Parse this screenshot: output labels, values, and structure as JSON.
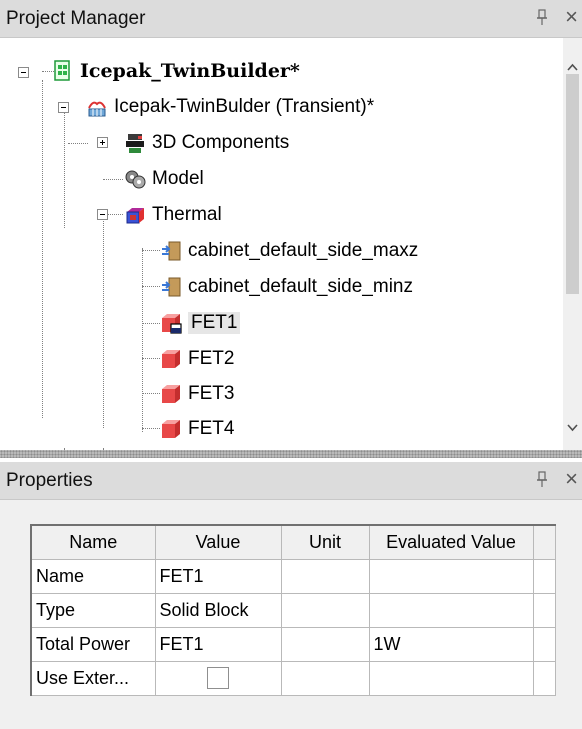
{
  "project_manager": {
    "title": "Project Manager",
    "pin_icon": "pin-icon",
    "close_icon": "close-icon",
    "close_glyph": "×"
  },
  "tree": {
    "project": {
      "label": "Icepak_TwinBuilder*",
      "icon": "project-icon"
    },
    "design": {
      "label": "Icepak-TwinBulder (Transient)*",
      "icon": "icepak-design-icon"
    },
    "components": {
      "label": "3D Components",
      "icon": "3d-components-icon"
    },
    "model": {
      "label": "Model",
      "icon": "model-icon"
    },
    "thermal": {
      "label": "Thermal",
      "icon": "thermal-icon"
    },
    "thermal_items": [
      {
        "label": "cabinet_default_side_maxz",
        "icon": "boundary-icon"
      },
      {
        "label": "cabinet_default_side_minz",
        "icon": "boundary-icon"
      },
      {
        "label": "FET1",
        "icon": "solid-block-icon",
        "selected": true
      },
      {
        "label": "FET2",
        "icon": "solid-block-icon"
      },
      {
        "label": "FET3",
        "icon": "solid-block-icon"
      },
      {
        "label": "FET4",
        "icon": "solid-block-icon"
      }
    ]
  },
  "properties": {
    "title": "Properties",
    "pin_icon": "pin-icon",
    "close_icon": "close-icon",
    "close_glyph": "×",
    "columns": [
      "Name",
      "Value",
      "Unit",
      "Evaluated Value"
    ],
    "rows": [
      {
        "name": "Name",
        "value": "FET1",
        "unit": "",
        "evaluated": ""
      },
      {
        "name": "Type",
        "value": "Solid Block",
        "unit": "",
        "evaluated": ""
      },
      {
        "name": "Total Power",
        "value": "FET1",
        "unit": "",
        "evaluated": "1W"
      },
      {
        "name": "Use Exter...",
        "value": "",
        "unit": "",
        "evaluated": "",
        "checkbox": false
      }
    ]
  },
  "colors": {
    "header_bg": "#dcdcdc",
    "block_red": "#e84848",
    "selection_bg": "#e6e6e6"
  }
}
